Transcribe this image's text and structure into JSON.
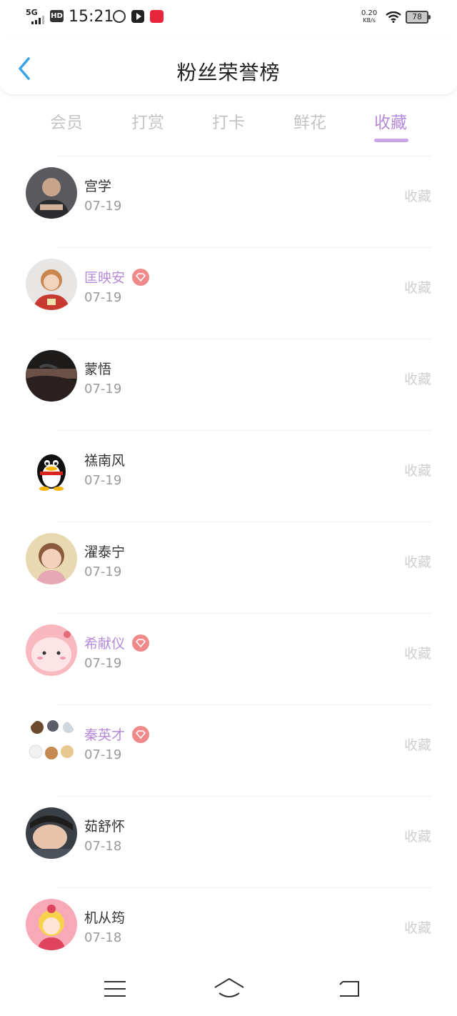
{
  "status": {
    "network": "5G",
    "hd": "HD",
    "time": "15:21",
    "speed_value": "0.20",
    "speed_unit": "KB/s",
    "battery": "78"
  },
  "header": {
    "title": "粉丝荣誉榜"
  },
  "tabs": [
    {
      "label": "会员"
    },
    {
      "label": "打赏"
    },
    {
      "label": "打卡"
    },
    {
      "label": "鲜花"
    },
    {
      "label": "收藏",
      "active": true
    }
  ],
  "users": [
    {
      "name": "宫学",
      "date": "07-19",
      "action": "收藏",
      "vip": false
    },
    {
      "name": "匡映安",
      "date": "07-19",
      "action": "收藏",
      "vip": true
    },
    {
      "name": "蒙悟",
      "date": "07-19",
      "action": "收藏",
      "vip": false
    },
    {
      "name": "禚南风",
      "date": "07-19",
      "action": "收藏",
      "vip": false
    },
    {
      "name": "濯泰宁",
      "date": "07-19",
      "action": "收藏",
      "vip": false
    },
    {
      "name": "希献仪",
      "date": "07-19",
      "action": "收藏",
      "vip": true
    },
    {
      "name": "秦英才",
      "date": "07-19",
      "action": "收藏",
      "vip": true
    },
    {
      "name": "茹舒怀",
      "date": "07-18",
      "action": "收藏",
      "vip": false
    },
    {
      "name": "机从筠",
      "date": "07-18",
      "action": "收藏",
      "vip": false
    }
  ],
  "colors": {
    "accent": "#b68ad8",
    "tab_inactive": "#c4c4c4",
    "vip_badge": "#f08a8a",
    "back_arrow": "#3aa3e6"
  },
  "icons": {
    "back": "chevron-left-icon",
    "vip": "diamond-icon",
    "nav_menu": "menu-icon",
    "nav_home": "home-icon",
    "nav_back": "back-icon"
  }
}
